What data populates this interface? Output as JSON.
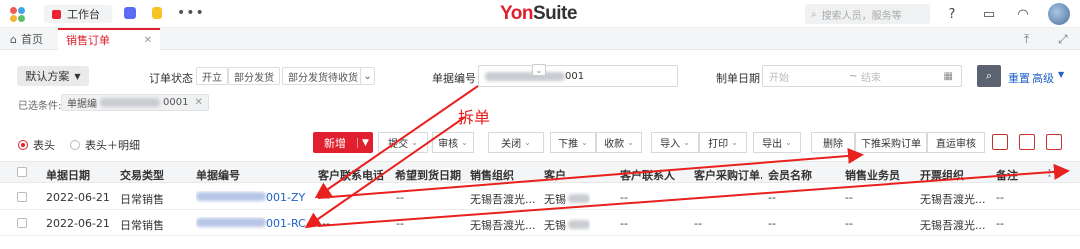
{
  "topbar": {
    "workspace_label": "工作台",
    "brand_prefix": "Yon",
    "brand_suffix": "Suite",
    "search_placeholder": "搜索人员，服务等",
    "more_icon": "more-dots-icon"
  },
  "tabs": {
    "home": "首页",
    "active": "销售订单"
  },
  "filter": {
    "scheme": "默认方案",
    "order_status_label": "订单状态",
    "status_chips": [
      "开立",
      "部分发货",
      "部分发货待收货"
    ],
    "doc_no_label": "单据编号",
    "doc_no_value_suffix": "001",
    "date_label": "制单日期",
    "date_start_placeholder": "开始",
    "date_sep": "~",
    "date_end_placeholder": "结束",
    "reset": "重置",
    "advanced": "高级",
    "selected_label": "已选条件:",
    "selected_chip_prefix": "单据编",
    "selected_chip_suffix": "0001"
  },
  "annotation": "拆单",
  "view": {
    "header_only": "表头",
    "header_detail": "表头＋明细"
  },
  "toolbar": {
    "new": "新增",
    "buttons": [
      "审核",
      "关闭",
      "下推",
      "收款",
      "导入",
      "打印",
      "导出",
      "删除",
      "下推采购订单",
      "直运审核"
    ],
    "partial_first": "提交"
  },
  "table": {
    "columns": [
      "单据日期",
      "交易类型",
      "单据编号",
      "客户联系电话",
      "希望到货日期",
      "销售组织",
      "客户",
      "客户联系人",
      "客户采购订单...",
      "会员名称",
      "销售业务员",
      "开票组织",
      "备注"
    ],
    "rows": [
      {
        "date": "2022-06-21",
        "type": "日常销售",
        "doc_suffix": "001-ZY",
        "phone": "--",
        "arrival": "--",
        "org": "无锡吾渡光...",
        "customer": "无锡",
        "contact": "--",
        "po": "--",
        "member": "--",
        "salesman": "--",
        "invoice_org": "无锡吾渡光...",
        "remark": "--"
      },
      {
        "date": "2022-06-21",
        "type": "日常销售",
        "doc_suffix": "001-RC",
        "phone": "--",
        "arrival": "--",
        "org": "无锡吾渡光...",
        "customer": "无锡",
        "contact": "--",
        "po": "--",
        "member": "--",
        "salesman": "--",
        "invoice_org": "无锡吾渡光...",
        "remark": "--"
      }
    ]
  },
  "colors": {
    "accent": "#e0202e",
    "link": "#2062c8",
    "annotation": "#e8201e"
  }
}
